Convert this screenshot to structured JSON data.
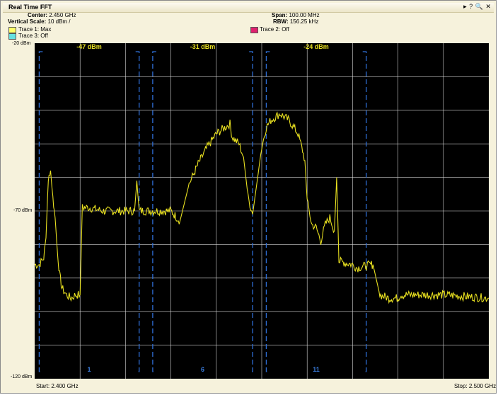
{
  "window": {
    "title": "Real Time FFT",
    "icons": [
      "arrow-right-icon",
      "help-icon",
      "zoom-icon",
      "close-icon"
    ],
    "icon_glyphs": [
      "▸",
      "?",
      "🔍",
      "✕"
    ]
  },
  "header": {
    "center_label": "Center:",
    "center_value": "2.450 GHz",
    "span_label": "Span:",
    "span_value": "100.00 MHz",
    "vscale_label": "Vertical Scale:",
    "vscale_value": "10 dBm /",
    "rbw_label": "RBW:",
    "rbw_value": "156.25 kHz"
  },
  "traces": [
    {
      "label": "Trace 1: Max",
      "color": "#ffff66"
    },
    {
      "label": "Trace 2: Off",
      "color": "#e0206e"
    },
    {
      "label": "Trace 3: Off",
      "color": "#66e0e0"
    }
  ],
  "axis": {
    "y_top": "-20 dBm",
    "y_mid": "-70 dBm",
    "y_bottom": "-120 dBm",
    "start": "Start: 2.400 GHz",
    "stop": "Stop: 2.500 GHz"
  },
  "channels": [
    {
      "number": "1",
      "peak": "-47 dBm"
    },
    {
      "number": "6",
      "peak": "-31 dBm"
    },
    {
      "number": "11",
      "peak": "-24 dBm"
    }
  ],
  "colors": {
    "trace": "#e8e020",
    "grid": "#d8d8d8",
    "channel_bracket": "#2f6fd8",
    "channel_number": "#3a7ee0",
    "peak_label": "#e8e020"
  },
  "chart_data": {
    "type": "line",
    "title": "",
    "xlabel": "",
    "ylabel": "",
    "x_unit": "GHz",
    "y_unit": "dBm",
    "xlim": [
      2.4,
      2.5
    ],
    "ylim": [
      -120,
      -20
    ],
    "grid": true,
    "series": [
      {
        "name": "Trace 1: Max",
        "x": [
          2.4,
          2.401,
          2.402,
          2.4025,
          2.403,
          2.4035,
          2.404,
          2.4045,
          2.405,
          2.4055,
          2.406,
          2.407,
          2.408,
          2.409,
          2.41,
          2.4105,
          2.411,
          2.412,
          2.415,
          2.42,
          2.422,
          2.4225,
          2.423,
          2.425,
          2.429,
          2.43,
          2.432,
          2.434,
          2.436,
          2.438,
          2.44,
          2.442,
          2.443,
          2.4435,
          2.445,
          2.446,
          2.447,
          2.448,
          2.449,
          2.45,
          2.451,
          2.452,
          2.453,
          2.454,
          2.456,
          2.458,
          2.459,
          2.4595,
          2.46,
          2.461,
          2.462,
          2.463,
          2.464,
          2.465,
          2.466,
          2.4665,
          2.467,
          2.47,
          2.471,
          2.474,
          2.4745,
          2.476,
          2.478,
          2.48,
          2.4805,
          2.49,
          2.5
        ],
        "y": [
          -86,
          -86,
          -84,
          -78,
          -60,
          -58,
          -66,
          -72,
          -82,
          -89,
          -93,
          -95,
          -96,
          -95,
          -95,
          -69,
          -69,
          -69,
          -70,
          -70,
          -70,
          -61,
          -70,
          -70,
          -70,
          -70,
          -73,
          -62,
          -56,
          -51,
          -47,
          -45,
          -44,
          -48,
          -50,
          -54,
          -66,
          -71,
          -61,
          -51,
          -45,
          -43,
          -42,
          -41,
          -43,
          -47,
          -52,
          -55,
          -67,
          -74,
          -75,
          -79,
          -74,
          -72,
          -76,
          -60,
          -85,
          -86,
          -87,
          -86,
          -86,
          -95,
          -96,
          -96,
          -95,
          -95,
          -96
        ]
      }
    ]
  }
}
